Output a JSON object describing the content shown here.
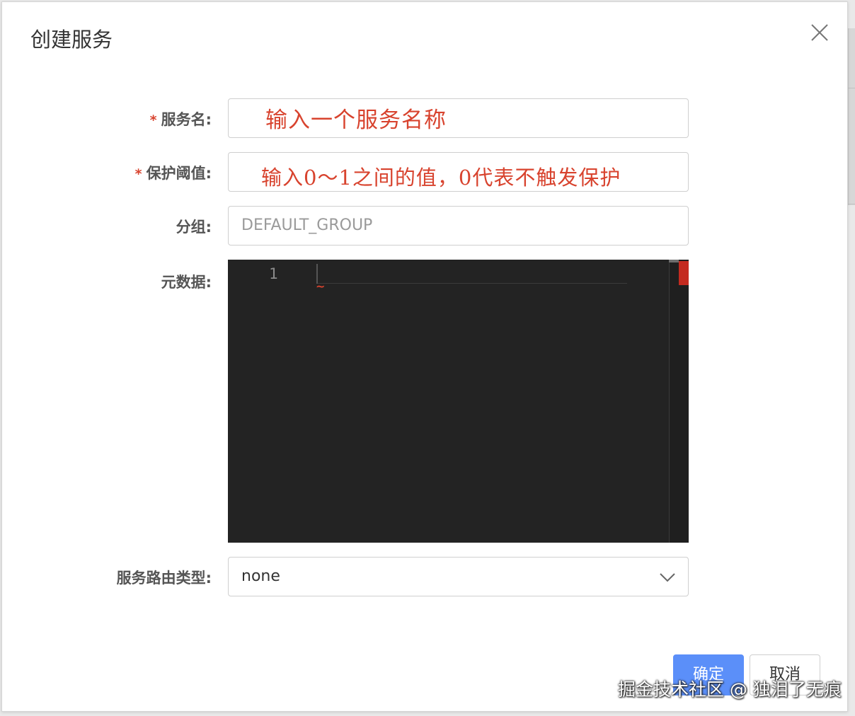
{
  "dialog": {
    "title": "创建服务",
    "close_icon": "close-icon"
  },
  "form": {
    "service_name": {
      "required_mark": "*",
      "label": "服务名:",
      "annotation": "输入一个服务名称"
    },
    "protect_threshold": {
      "required_mark": "*",
      "label": "保护阈值:",
      "annotation": "输入0～1之间的值，0代表不触发保护"
    },
    "group": {
      "label": "分组:",
      "placeholder": "DEFAULT_GROUP"
    },
    "metadata": {
      "label": "元数据:",
      "line_number": "1"
    },
    "route_type": {
      "label": "服务路由类型:",
      "value": "none",
      "icon": "chevron-down-icon"
    }
  },
  "footer": {
    "ok_label": "确定",
    "cancel_label": "取消"
  },
  "watermark": "掘金技术社区 @ 独泪了无痕",
  "colors": {
    "primary": "#5b8ff9",
    "annotation_red": "#d8432e",
    "editor_bg": "#232323"
  }
}
